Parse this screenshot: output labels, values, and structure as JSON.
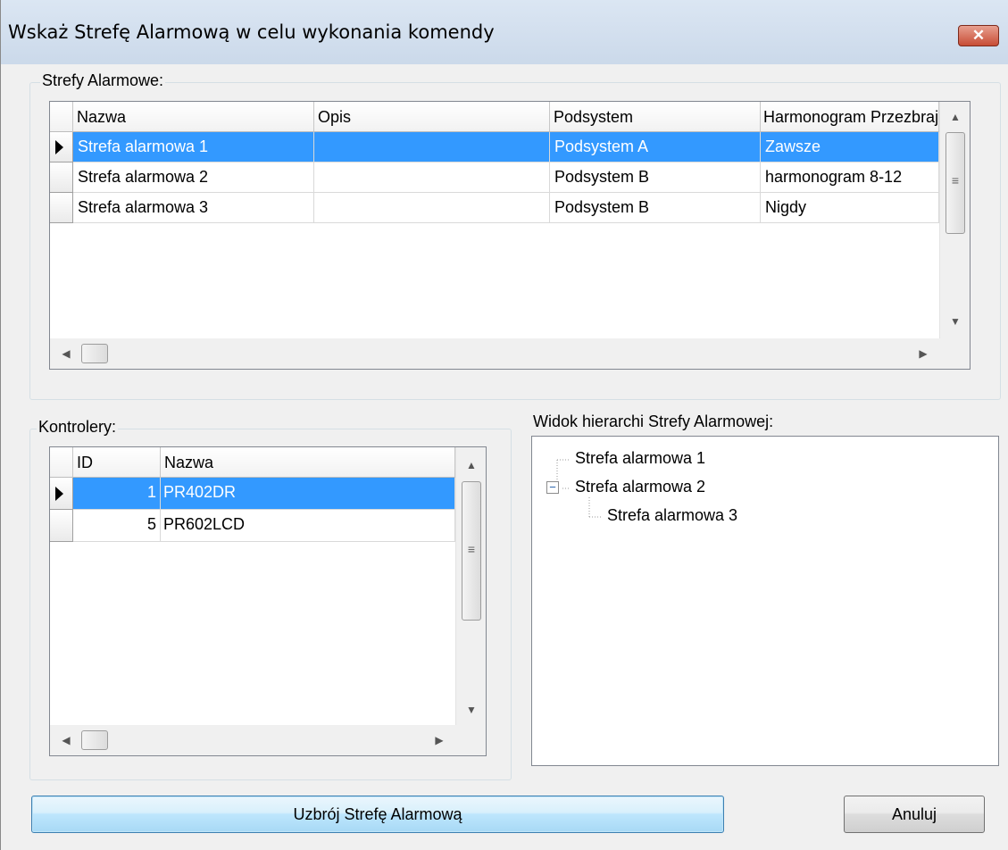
{
  "window": {
    "title": "Wskaż Strefę Alarmową w celu wykonania komendy",
    "close_label": "✕"
  },
  "zones": {
    "label": "Strefy Alarmowe:",
    "columns": [
      "Nazwa",
      "Opis",
      "Podsystem",
      "Harmonogram Przezbrajar"
    ],
    "rows": [
      {
        "name": "Strefa alarmowa 1",
        "desc": "",
        "subsystem": "Podsystem A",
        "schedule": "Zawsze",
        "selected": true
      },
      {
        "name": "Strefa alarmowa 2",
        "desc": "",
        "subsystem": "Podsystem B",
        "schedule": "harmonogram 8-12",
        "selected": false
      },
      {
        "name": "Strefa alarmowa 3",
        "desc": "",
        "subsystem": "Podsystem B",
        "schedule": "Nigdy",
        "selected": false
      }
    ]
  },
  "controllers": {
    "label": "Kontrolery:",
    "columns": [
      "ID",
      "Nazwa"
    ],
    "rows": [
      {
        "id": "1",
        "name": "PR402DR",
        "selected": true
      },
      {
        "id": "5",
        "name": "PR602LCD",
        "selected": false
      }
    ]
  },
  "hierarchy": {
    "label": "Widok hierarchi Strefy Alarmowej:",
    "nodes": [
      {
        "label": "Strefa alarmowa 1",
        "level": 0,
        "expander": ""
      },
      {
        "label": "Strefa alarmowa 2",
        "level": 0,
        "expander": "−"
      },
      {
        "label": "Strefa alarmowa 3",
        "level": 1,
        "expander": ""
      }
    ]
  },
  "buttons": {
    "arm": "Uzbrój Strefę Alarmową",
    "cancel": "Anuluj"
  },
  "glyphs": {
    "up": "▲",
    "down": "▼",
    "left": "◀",
    "right": "▶",
    "grip": "≡"
  }
}
